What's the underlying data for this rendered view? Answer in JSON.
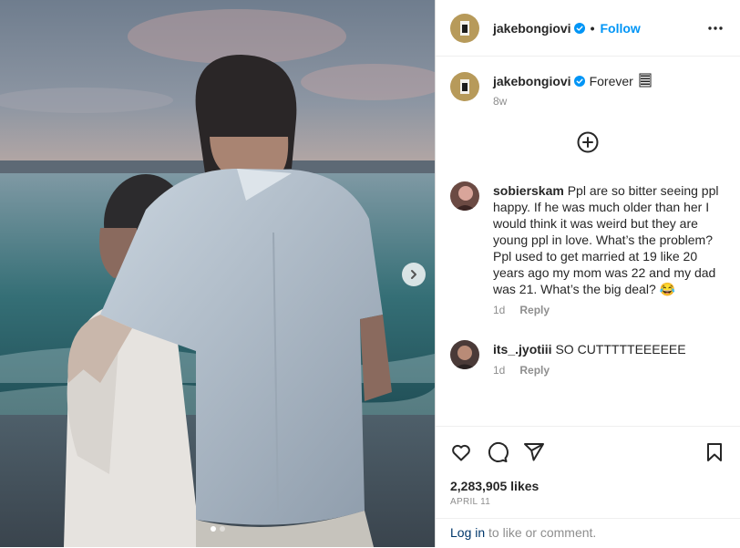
{
  "post": {
    "author": "jakebongiovi",
    "follow_label": "Follow",
    "separator": "•",
    "caption": "Forever",
    "caption_emoji": "ring-emoji",
    "caption_ago": "8w",
    "likes": "2,283,905 likes",
    "date": "APRIL 11",
    "login_link": "Log in",
    "login_suffix": " to like or comment.",
    "carousel": {
      "current": 1,
      "total": 2
    }
  },
  "comments": [
    {
      "user": "sobierskam",
      "text": "Ppl are so bitter seeing ppl happy. If he was much older than her I would think it was weird but they are young ppl in love. What’s the problem? Ppl used to get married at 19 like 20 years ago my mom was 22 and my dad was 21. What’s the big deal? 😂",
      "ago": "1d",
      "reply": "Reply"
    },
    {
      "user": "its_.jyotiii",
      "text": "SO CUTTTTTEEEEEE",
      "ago": "1d",
      "reply": "Reply"
    }
  ],
  "icons": [
    "heart-icon",
    "comment-icon",
    "share-icon",
    "bookmark-icon",
    "more-icon",
    "add-comment-icon",
    "chevron-right-icon",
    "verified-badge-icon"
  ],
  "colors": {
    "link": "#0095f6",
    "verified": "#0095f6",
    "muted": "#8e8e8e",
    "text": "#262626"
  }
}
